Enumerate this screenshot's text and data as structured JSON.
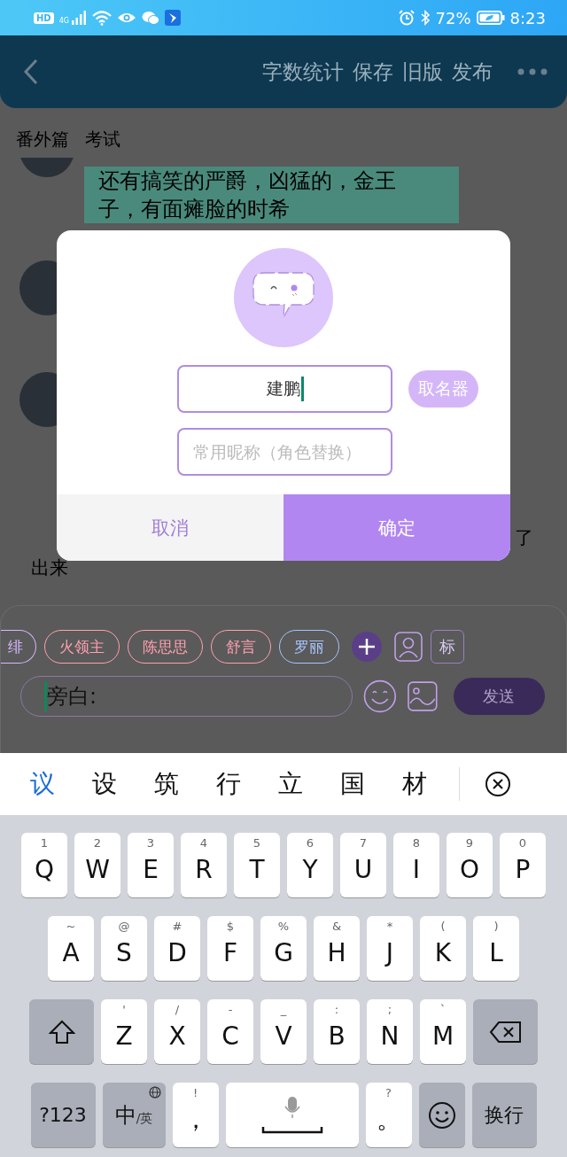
{
  "status_bar": {
    "hd_badge": "HD",
    "network": "4G",
    "battery": "72%",
    "time": "8:23"
  },
  "header": {
    "actions": [
      "字数统计",
      "保存",
      "旧版",
      "发布"
    ]
  },
  "title": {
    "volume": "番外篇",
    "chapter": "考试"
  },
  "messages": [
    {
      "kind": "bubble",
      "text": "还有搞笑的严爵，凶猛的，金王子，有面瘫脸的时希"
    },
    {
      "kind": "avatar"
    },
    {
      "kind": "avatar"
    },
    {
      "kind": "narration",
      "lines": [
        "了",
        "出来"
      ]
    }
  ],
  "roles": [
    {
      "name": "绯",
      "color": "#d8b8ff"
    },
    {
      "name": "火领主",
      "color": "#ffa0b0"
    },
    {
      "name": "陈思思",
      "color": "#ffa0b0"
    },
    {
      "name": "舒言",
      "color": "#ffa0b0"
    },
    {
      "name": "罗丽",
      "color": "#a8c4ff"
    }
  ],
  "role_tag_button": "标",
  "composer": {
    "placeholder": "旁白:",
    "focused": true,
    "send": "发送"
  },
  "dialog": {
    "name_field": {
      "value": "建鹏",
      "focused": true
    },
    "name_generator": "取名器",
    "nickname_field": {
      "placeholder": "常用昵称（角色替换）"
    },
    "cancel": "取消",
    "confirm": "确定"
  },
  "candidates": [
    {
      "text": "议",
      "selected": true
    },
    {
      "text": "设",
      "selected": false
    },
    {
      "text": "筑",
      "selected": false
    },
    {
      "text": "行",
      "selected": false
    },
    {
      "text": "立",
      "selected": false
    },
    {
      "text": "国",
      "selected": false
    },
    {
      "text": "材",
      "selected": false
    }
  ],
  "keyboard": [
    [
      {
        "kind": "char",
        "label": "Q",
        "hint": "1"
      },
      {
        "kind": "char",
        "label": "W",
        "hint": "2"
      },
      {
        "kind": "char",
        "label": "E",
        "hint": "3"
      },
      {
        "kind": "char",
        "label": "R",
        "hint": "4"
      },
      {
        "kind": "char",
        "label": "T",
        "hint": "5"
      },
      {
        "kind": "char",
        "label": "Y",
        "hint": "6"
      },
      {
        "kind": "char",
        "label": "U",
        "hint": "7"
      },
      {
        "kind": "char",
        "label": "I",
        "hint": "8"
      },
      {
        "kind": "char",
        "label": "O",
        "hint": "9"
      },
      {
        "kind": "char",
        "label": "P",
        "hint": "0"
      }
    ],
    [
      {
        "kind": "char",
        "label": "A",
        "hint": "~"
      },
      {
        "kind": "char",
        "label": "S",
        "hint": "@"
      },
      {
        "kind": "char",
        "label": "D",
        "hint": "#"
      },
      {
        "kind": "char",
        "label": "F",
        "hint": "$"
      },
      {
        "kind": "char",
        "label": "G",
        "hint": "%"
      },
      {
        "kind": "char",
        "label": "H",
        "hint": "&"
      },
      {
        "kind": "char",
        "label": "J",
        "hint": "*"
      },
      {
        "kind": "char",
        "label": "K",
        "hint": "("
      },
      {
        "kind": "char",
        "label": "L",
        "hint": ")"
      }
    ],
    [
      {
        "kind": "shift"
      },
      {
        "kind": "char",
        "label": "Z",
        "hint": "'"
      },
      {
        "kind": "char",
        "label": "X",
        "hint": "/"
      },
      {
        "kind": "char",
        "label": "C",
        "hint": "-"
      },
      {
        "kind": "char",
        "label": "V",
        "hint": "_"
      },
      {
        "kind": "char",
        "label": "B",
        "hint": ":"
      },
      {
        "kind": "char",
        "label": "N",
        "hint": ";"
      },
      {
        "kind": "char",
        "label": "M",
        "hint": "`"
      },
      {
        "kind": "backspace"
      }
    ],
    [
      {
        "kind": "mode",
        "label": "?123"
      },
      {
        "kind": "lang",
        "label": "中",
        "sub": "/英"
      },
      {
        "kind": "char",
        "label": "，",
        "hint": "!"
      },
      {
        "kind": "space"
      },
      {
        "kind": "char",
        "label": "。",
        "hint": "?"
      },
      {
        "kind": "emoji"
      },
      {
        "kind": "mode",
        "label": "换行"
      }
    ]
  ]
}
